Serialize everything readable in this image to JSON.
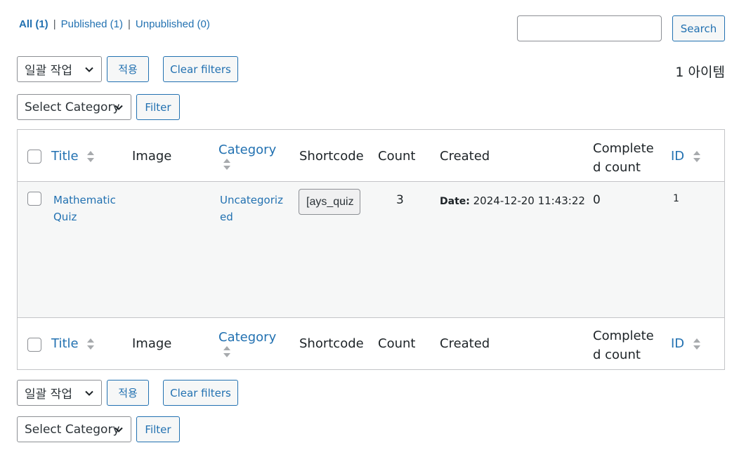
{
  "filters": {
    "all_label": "All",
    "all_count": "(1)",
    "published_label": "Published",
    "published_count": "(1)",
    "unpublished_label": "Unpublished",
    "unpublished_count": "(0)",
    "separator": "|"
  },
  "search": {
    "value": "",
    "button_label": "Search"
  },
  "top_actions": {
    "bulk_select": "일괄 작업",
    "apply_label": "적용",
    "clear_filters_label": "Clear filters",
    "category_select": "Select Category",
    "filter_label": "Filter",
    "items_count": "1 아이템"
  },
  "table": {
    "columns": {
      "title": "Title",
      "image": "Image",
      "category": "Category",
      "shortcode": "Shortcode",
      "count": "Count",
      "created": "Created",
      "completed_line1": "Complete",
      "completed_line2": "d count",
      "id": "ID"
    },
    "rows": [
      {
        "title_line1": "Mathematic",
        "title_line2": "Quiz",
        "category_line1": "Uncategoriz",
        "category_line2": "ed",
        "shortcode": "[ays_quiz",
        "count": "3",
        "created_label": "Date:",
        "created_value": "2024-12-20 11:43:22",
        "completed_count": "0",
        "id": "1"
      }
    ]
  },
  "bottom_actions": {
    "bulk_select": "일괄 작업",
    "apply_label": "적용",
    "clear_filters_label": "Clear filters",
    "category_select": "Select Category",
    "filter_label": "Filter"
  },
  "colors": {
    "link": "#2271b1",
    "border": "#c3c4c7",
    "row_bg": "#f6f7f7"
  },
  "icons": {
    "sort": "sort-updown-icon",
    "chevron": "chevron-down-icon"
  }
}
